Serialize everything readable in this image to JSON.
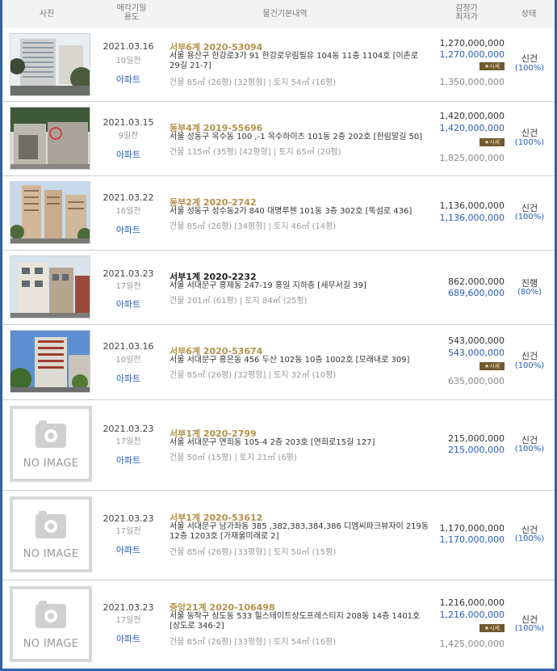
{
  "header": {
    "photo": "사진",
    "date_line1": "매각기일",
    "date_line2": "용도",
    "info": "물건기본내역",
    "price_line1": "감정가",
    "price_line2": "최저가",
    "status": "상태"
  },
  "market_badge": "시세",
  "no_image": "NO IMAGE",
  "rows": [
    {
      "date": "2021.03.16",
      "days": "10일전",
      "type": "아파트",
      "case": "서부6계 2020-53094",
      "addr": "서울 용산구 한강로3가 91 한강로우림필유 104동 11층 1104호 [이촌로 29길 21-7]",
      "area": "건물 85㎡ (26평) [32평형]  |  토지 54㎡ (16평)",
      "appraisal": "1,270,000,000",
      "min": "1,270,000,000",
      "market": "1,350,000,000",
      "status": "신건",
      "rate": "(100%)"
    },
    {
      "date": "2021.03.15",
      "days": "9일전",
      "type": "아파트",
      "case": "동부4계 2019-55696",
      "addr": "서울 성동구 옥수동 100 ,-1 옥수하이츠 101동 2층 202호 [한림말길 50]",
      "area": "건물 115㎡ (35평) [42평형]  |  토지 65㎡ (20평)",
      "appraisal": "1,420,000,000",
      "min": "1,420,000,000",
      "market": "1,825,000,000",
      "status": "신건",
      "rate": "(100%)"
    },
    {
      "date": "2021.03.22",
      "days": "16일전",
      "type": "아파트",
      "case": "동부2계 2020-2742",
      "addr": "서울 성동구 성수동2가 840 대명루첸 101동 3층 302호 [뚝섬로 436]",
      "area": "건물 85㎡ (26평) [34평형]  |  토지 46㎡ (14평)",
      "appraisal": "1,136,000,000",
      "min": "1,136,000,000",
      "market": "",
      "status": "신건",
      "rate": "(100%)"
    },
    {
      "date": "2021.03.23",
      "days": "17일전",
      "type": "아파트",
      "case": "서부1계 2020-2232",
      "addr": "서울 서대문구 홍제동 247-19 홍일 지하층 [세무서길 39]",
      "area": "건물 201㎡ (61평)  |  토지 84㎡ (25평)",
      "appraisal": "862,000,000",
      "min": "689,600,000",
      "market": "",
      "status": "진행",
      "rate": "(80%)"
    },
    {
      "date": "2021.03.16",
      "days": "10일전",
      "type": "아파트",
      "case": "서부6계 2020-53674",
      "addr": "서울 서대문구 홍은동 456 두산 102동 10층 1002호 [모래내로 309]",
      "area": "건물 85㎡ (26평) [32평형]  |  토지 32㎡ (10평)",
      "appraisal": "543,000,000",
      "min": "543,000,000",
      "market": "635,000,000",
      "status": "신건",
      "rate": "(100%)"
    },
    {
      "date": "2021.03.23",
      "days": "17일전",
      "type": "아파트",
      "case": "서부1계 2020-2799",
      "addr": "서울 서대문구 연희동 105-4 2층 203호 [연희로15길 127]",
      "area": "건물 50㎡ (15평)  |  토지 21㎡ (6평)",
      "appraisal": "215,000,000",
      "min": "215,000,000",
      "market": "",
      "status": "신건",
      "rate": "(100%)"
    },
    {
      "date": "2021.03.23",
      "days": "17일전",
      "type": "아파트",
      "case": "서부1계 2020-53612",
      "addr": "서울 서대문구 남가좌동 385 ,382,383,384,386 디엠씨파크뷰자이 219동 12층 1203호 [가재울미래로 2]",
      "area": "건물 85㎡ (26평) [33평형]  |  토지 50㎡ (15평)",
      "appraisal": "1,170,000,000",
      "min": "1,170,000,000",
      "market": "",
      "status": "신건",
      "rate": "(100%)"
    },
    {
      "date": "2021.03.23",
      "days": "17일전",
      "type": "아파트",
      "case": "중앙21계 2020-106498",
      "addr": "서울 동작구 상도동 533 힐스테이트상도프레스티지 208동 14층 1401호 [상도로 346-2]",
      "area": "건물 85㎡ (26평) [33평형]  |  토지 54㎡ (16평)",
      "appraisal": "1,216,000,000",
      "min": "1,216,000,000",
      "market": "1,425,000,000",
      "status": "신건",
      "rate": "(100%)"
    }
  ]
}
